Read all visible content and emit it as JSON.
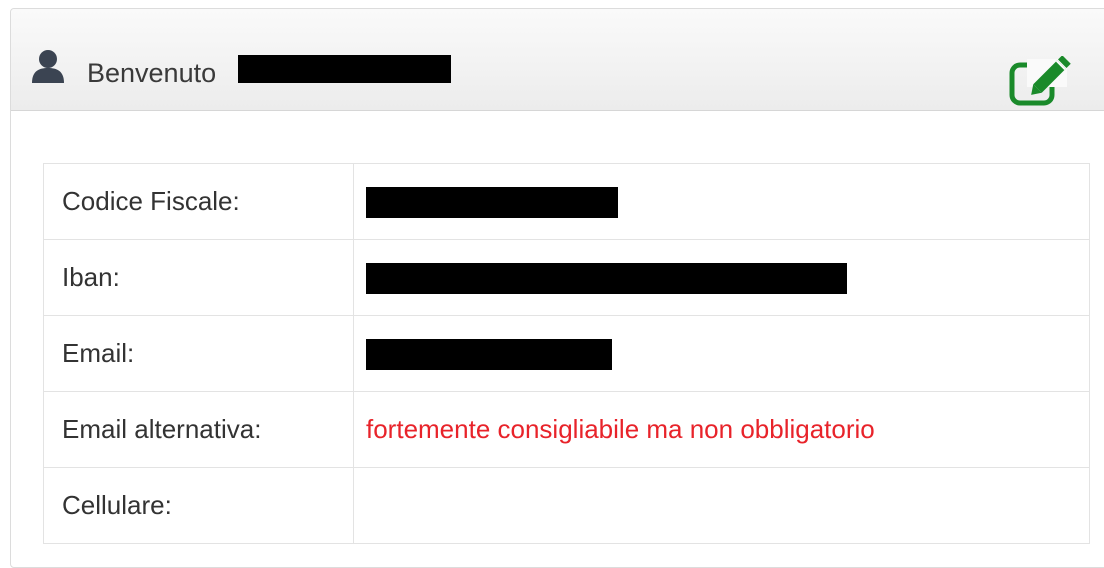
{
  "header": {
    "welcome_label": "Benvenuto",
    "user_icon": "user-icon",
    "edit_icon": "edit-icon",
    "edit_color": "#1a8a2a"
  },
  "profile": {
    "rows": [
      {
        "label": "Codice Fiscale:",
        "value": "",
        "redacted": true
      },
      {
        "label": "Iban:",
        "value": "",
        "redacted": true
      },
      {
        "label": "Email:",
        "value": "",
        "redacted": true
      },
      {
        "label": "Email alternativa:",
        "value": "fortemente consigliabile ma non obbligatorio",
        "redacted": false
      },
      {
        "label": "Cellulare:",
        "value": "",
        "redacted": false
      }
    ]
  },
  "colors": {
    "hint": "#e8232a",
    "text": "#333333"
  }
}
